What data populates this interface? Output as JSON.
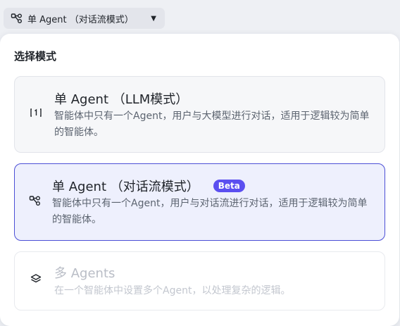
{
  "trigger": {
    "label": "单 Agent （对话流模式）",
    "caret": "▼"
  },
  "panel": {
    "title": "选择模式",
    "options": [
      {
        "title": "单 Agent （LLM模式）",
        "desc": "智能体中只有一个Agent，用户与大模型进行对话，适用于逻辑较为简单的智能体。",
        "icon": "single-agent-icon"
      },
      {
        "title": "单 Agent （对话流模式）",
        "badge": "Beta",
        "desc": "智能体中只有一个Agent，用户与对话流进行对话，适用于逻辑较为简单的智能体。",
        "icon": "workflow-icon",
        "selected": true
      },
      {
        "title": "多 Agents",
        "desc": "在一个智能体中设置多个Agent，以处理复杂的逻辑。",
        "icon": "layers-icon",
        "disabled": true
      }
    ]
  },
  "colors": {
    "accent": "#4c4fd6",
    "badge": "#5b4ff0",
    "selected_bg": "#eef0fd"
  }
}
